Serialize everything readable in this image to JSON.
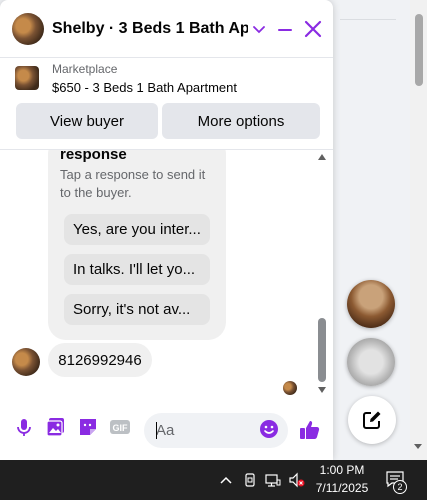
{
  "chat": {
    "title": "Shelby · 3 Beds 1 Bath Apa...",
    "accent_color": "#8a2be2",
    "icons": {
      "chevron": "chevron-down-icon",
      "minimize": "minimize-icon",
      "close": "close-icon"
    }
  },
  "marketplace": {
    "label": "Marketplace",
    "listing": "$650 - 3 Beds 1 Bath Apartment",
    "view_buyer": "View buyer",
    "more_options": "More options"
  },
  "messages": {
    "card_heading": "response",
    "card_subtext": "Tap a response to send it to the buyer.",
    "quick_responses": [
      "Yes, are you inter...",
      "In talks. I'll let yo...",
      "Sorry, it's not av..."
    ],
    "phone_message": "8126992946"
  },
  "composer": {
    "placeholder": "Aa",
    "icons": [
      "microphone-icon",
      "photo-icon",
      "sticker-icon",
      "gif-icon",
      "emoji-icon",
      "thumbs-up-icon"
    ],
    "gif_label": "GIF"
  },
  "taskbar": {
    "time": "1:00 PM",
    "date": "7/11/2025",
    "notification_count": "2"
  }
}
